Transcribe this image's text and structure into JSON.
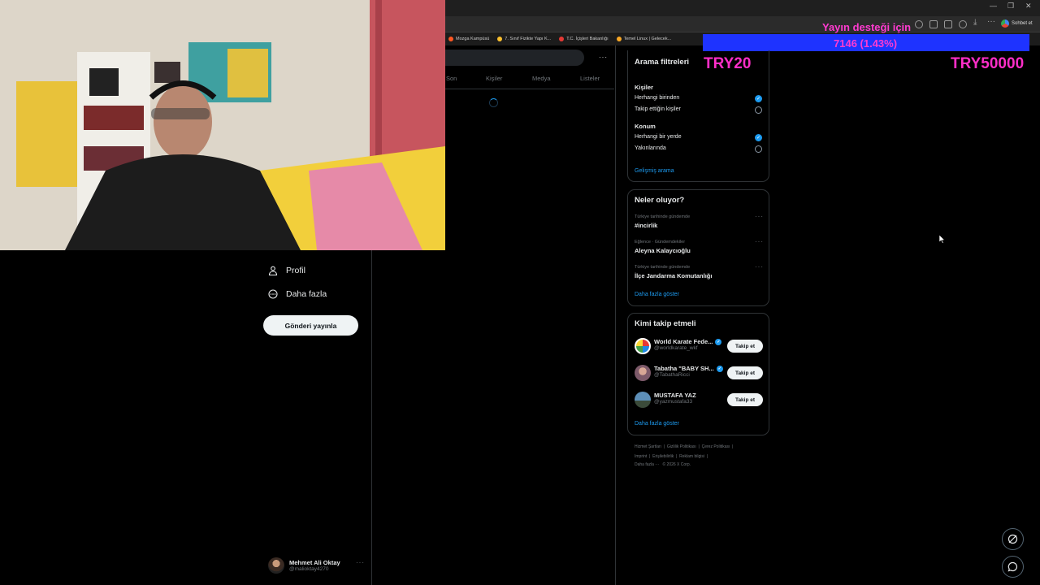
{
  "bookmarks": [
    "Mozga Kampüsü",
    "7. Sınıf Fizikte Yapı K...",
    "T.C. İçişleri Bakanlığı",
    "Temel Linux | Gelecek..."
  ],
  "browser": {
    "chat_label": "Sohbet et"
  },
  "overlay": {
    "donation_title": "Yayın desteği için",
    "donation_amount": "7146 (1.43%)",
    "goal_min": "TRY20",
    "goal_max": "TRY50000",
    "bar_color": "#1e33ff",
    "text_color": "#ff2ec8"
  },
  "nav": {
    "profile": "Profil",
    "more": "Daha fazla",
    "post_button": "Gönderi yayınla"
  },
  "account": {
    "name": "Mehmet Ali Oktay",
    "handle": "@malioktay4270"
  },
  "search_tabs": [
    "Son",
    "Kişiler",
    "Medya",
    "Listeler"
  ],
  "filters": {
    "title": "Arama filtreleri",
    "people_heading": "Kişiler",
    "people_options": [
      "Herhangi birinden",
      "Takip ettiğin kişiler"
    ],
    "location_heading": "Konum",
    "location_options": [
      "Herhangi bir yerde",
      "Yakınlarında"
    ],
    "advanced": "Gelişmiş arama"
  },
  "trends": {
    "title": "Neler oluyor?",
    "items": [
      {
        "meta": "Türkiye tarihinde gündemde",
        "name": "#incirlik"
      },
      {
        "meta": "Eğlence · Gündemdekiler",
        "name": "Aleyna Kalaycıoğlu"
      },
      {
        "meta": "Türkiye tarihinde gündemde",
        "name": "İlçe Jandarma Komutanlığı"
      }
    ],
    "show_more": "Daha fazla göster"
  },
  "who_to_follow": {
    "title": "Kimi takip etmeli",
    "users": [
      {
        "name": "World Karate Fede...",
        "handle": "@worldkarate_wkf",
        "verified": true,
        "button": "Takip et"
      },
      {
        "name": "Tabatha \"BABY SH...",
        "handle": "@TabathaRicci",
        "verified": true,
        "button": "Takip et"
      },
      {
        "name": "MUSTAFA YAZ",
        "handle": "@yazmustafa33",
        "verified": false,
        "button": "Takip et"
      }
    ],
    "show_more": "Daha fazla göster"
  },
  "footer": {
    "line1": [
      "Hizmet Şartları",
      "Gizlilik Politikası",
      "Çerez Politikası"
    ],
    "line2": [
      "Imprint",
      "Erişilebilirlik",
      "Reklam bilgisi"
    ],
    "more": "Daha fazla ···",
    "copyright": "© 2026 X Corp."
  }
}
